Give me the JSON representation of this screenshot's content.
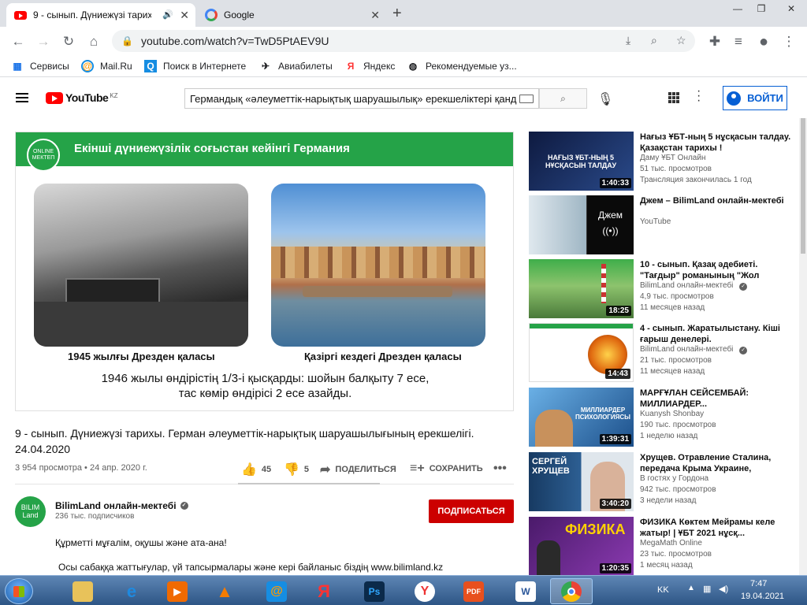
{
  "browser": {
    "tabs": [
      {
        "title": "9 - сынып. Дүниежүзі тарих",
        "active": true,
        "icon": "youtube-icon"
      },
      {
        "title": "Google",
        "active": false,
        "icon": "google-icon"
      }
    ],
    "url": "youtube.com/watch?v=TwD5PtAEV9U",
    "bookmarks": [
      "Сервисы",
      "Mail.Ru",
      "Поиск в Интернете",
      "Авиабилеты",
      "Яндекс",
      "Рекомендуемые уз..."
    ]
  },
  "youtube": {
    "logo": "YouTube",
    "country": "KZ",
    "search_value": "Германдық «әлеуметтік-нарықтық шаруашылық» ерекшеліктері қанд",
    "sign_in": "ВОЙТИ"
  },
  "video": {
    "slide_logo": "ONLINE МЕКТЕП",
    "slide_title": "Екінші дүниежүзілік соғыстан кейінгі Германия",
    "caption_left": "1945 жылғы Дрезден қаласы",
    "caption_right": "Қазіргі кездегі Дрезден қаласы",
    "slide_text_1": "1946 жылы өндірістің 1/3-і қысқарды: шойын балқыту 7 есе,",
    "slide_text_2": "тас көмір өндірісі 2 есе  азайды.",
    "title": "9 - сынып. Дүниежүзі тарихы. Герман әлеуметтік-нарықтық шаруашылығының ерекшелігі. 24.04.2020",
    "views_date": "3 954 просмотра • 24 апр. 2020 г.",
    "likes": "45",
    "dislikes": "5",
    "share": "ПОДЕЛИТЬСЯ",
    "save": "СОХРАНИТЬ"
  },
  "channel": {
    "avatar_text": "BILIM Land",
    "name": "BilimLand онлайн-мектебі",
    "subscribers": "236 тыс. подписчиков",
    "subscribe": "ПОДПИСАТЬСЯ",
    "desc_1": "Құрметті мұғалім, оқушы және ата-ана!",
    "desc_2": "Осы сабаққа жаттығулар, үй тапсырмалары және кері байланыс біздің www.bilimland.kz"
  },
  "recommendations": [
    {
      "title": "Нағыз ҰБТ-ның 5 нұсқасын талдау. Қазақстан тарихы !",
      "channel": "Даму ҰБТ Онлайн",
      "views": "51 тыс. просмотров",
      "time": "Трансляция закончилась 1 год",
      "duration": "1:40:33",
      "thumb_text": "НАҒЫЗ ҰБТ-НЫҢ 5 НҰСҚАСЫН ТАЛДАУ",
      "color": "#1b2a5c"
    },
    {
      "title": "Джем – BilimLand онлайн-мектебі",
      "channel": "YouTube",
      "views": "",
      "time": "",
      "duration": "",
      "thumb_text": "Джем",
      "color": "#9fb6c4"
    },
    {
      "title": "10 - сынып. Қазақ әдебиеті. \"Тағдыр\" романының \"Жол",
      "channel": "BilimLand онлайн-мектебі",
      "views": "4,9 тыс. просмотров",
      "time": "11 месяцев назад",
      "duration": "18:25",
      "thumb_text": "",
      "color": "#5aa84a"
    },
    {
      "title": "4 - сынып. Жаратылыстану. Кіші ғарыш денелері.",
      "channel": "BilimLand онлайн-мектебі",
      "views": "21 тыс. просмотров",
      "time": "11 месяцев назад",
      "duration": "14:43",
      "thumb_text": "",
      "color": "#ffffff"
    },
    {
      "title": "МАРҒҰЛАН СЕЙСЕМБАЙ: МИЛЛИАРДЕР...",
      "channel": "Kuanysh Shonbay",
      "views": "190 тыс. просмотров",
      "time": "1 неделю назад",
      "duration": "1:39:31",
      "thumb_text": "МИЛЛИАРДЕР ПСИХОЛОГИЯСЫ",
      "color": "#2a6fb0"
    },
    {
      "title": "Хрущев. Отравление Сталина, передача Крыма Украине,",
      "channel": "В гостях у Гордона",
      "views": "942 тыс. просмотров",
      "time": "3 недели назад",
      "duration": "3:40:20",
      "thumb_text": "СЕРГЕЙ ХРУЩЕВ",
      "color": "#1d3f66"
    },
    {
      "title": "ФИЗИКА Көктем Мейрамы келе жатыр! | ҰБТ 2021 нұсқ...",
      "channel": "MegaMath Online",
      "views": "23 тыс. просмотров",
      "time": "1 месяц назад",
      "duration": "1:20:35",
      "thumb_text": "ФИЗИКА",
      "color": "#6a2a8c"
    }
  ],
  "taskbar": {
    "lang": "KK",
    "time": "7:47",
    "date": "19.04.2021"
  }
}
